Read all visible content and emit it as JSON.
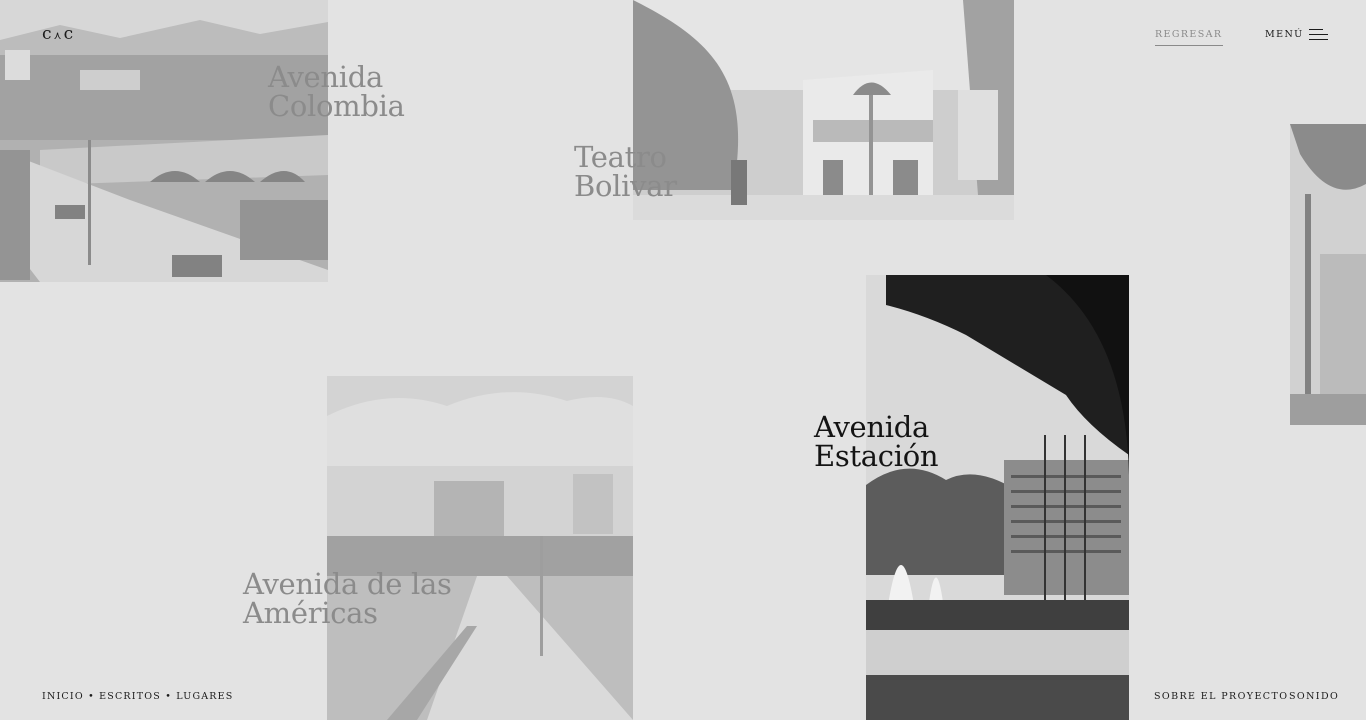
{
  "header": {
    "logo_left": "c",
    "logo_sep": "⋏",
    "logo_right": "c",
    "back_label": "REGRESAR",
    "menu_label": "MENÚ"
  },
  "places": [
    {
      "title": "Avenida\nColombia",
      "active": false
    },
    {
      "title": "Teatro\nBolivar",
      "active": false
    },
    {
      "title": "Avenida de las\nAméricas",
      "active": false
    },
    {
      "title": "Avenida\nEstación",
      "active": true
    }
  ],
  "footer": {
    "breadcrumb": [
      "INICIO",
      "ESCRITOS",
      "LUGARES"
    ],
    "separator": "•",
    "about_label": "SOBRE EL PROYECTO",
    "sound_label": "SONIDO"
  },
  "colors": {
    "background": "#e3e3e3",
    "active_title": "#141414",
    "inactive_title": "#8b8b8b"
  }
}
